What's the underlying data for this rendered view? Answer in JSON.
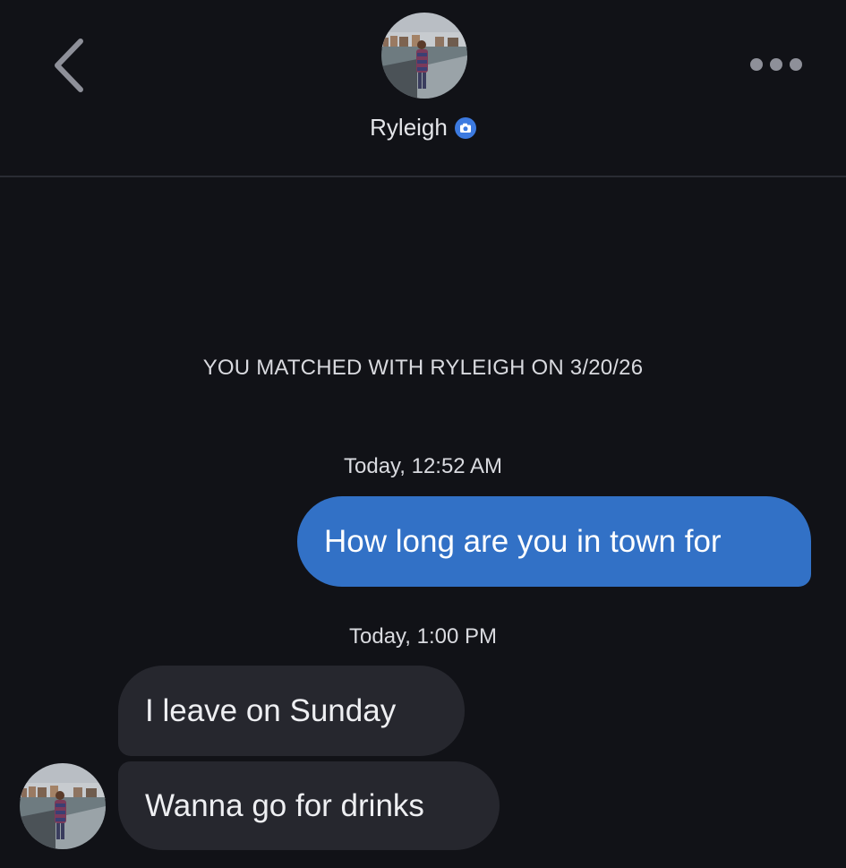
{
  "header": {
    "contact_name": "Ryleigh",
    "verified_icon": "camera-verified-icon",
    "back_icon": "chevron-left-icon",
    "more_icon": "more-dots-icon"
  },
  "conversation": {
    "match_notice": "YOU MATCHED WITH RYLEIGH ON 3/20/26",
    "groups": [
      {
        "timestamp": "Today, 12:52 AM",
        "messages": [
          {
            "direction": "outgoing",
            "text": "How long are you in town for"
          }
        ]
      },
      {
        "timestamp": "Today, 1:00 PM",
        "messages": [
          {
            "direction": "incoming",
            "text": "I leave on Sunday"
          },
          {
            "direction": "incoming",
            "text": "Wanna go for drinks"
          }
        ]
      }
    ]
  },
  "colors": {
    "background": "#111217",
    "outgoing_bubble": "#3271c6",
    "incoming_bubble": "#26272e",
    "verified_badge": "#3c7ae0",
    "divider": "#2a2c33"
  }
}
